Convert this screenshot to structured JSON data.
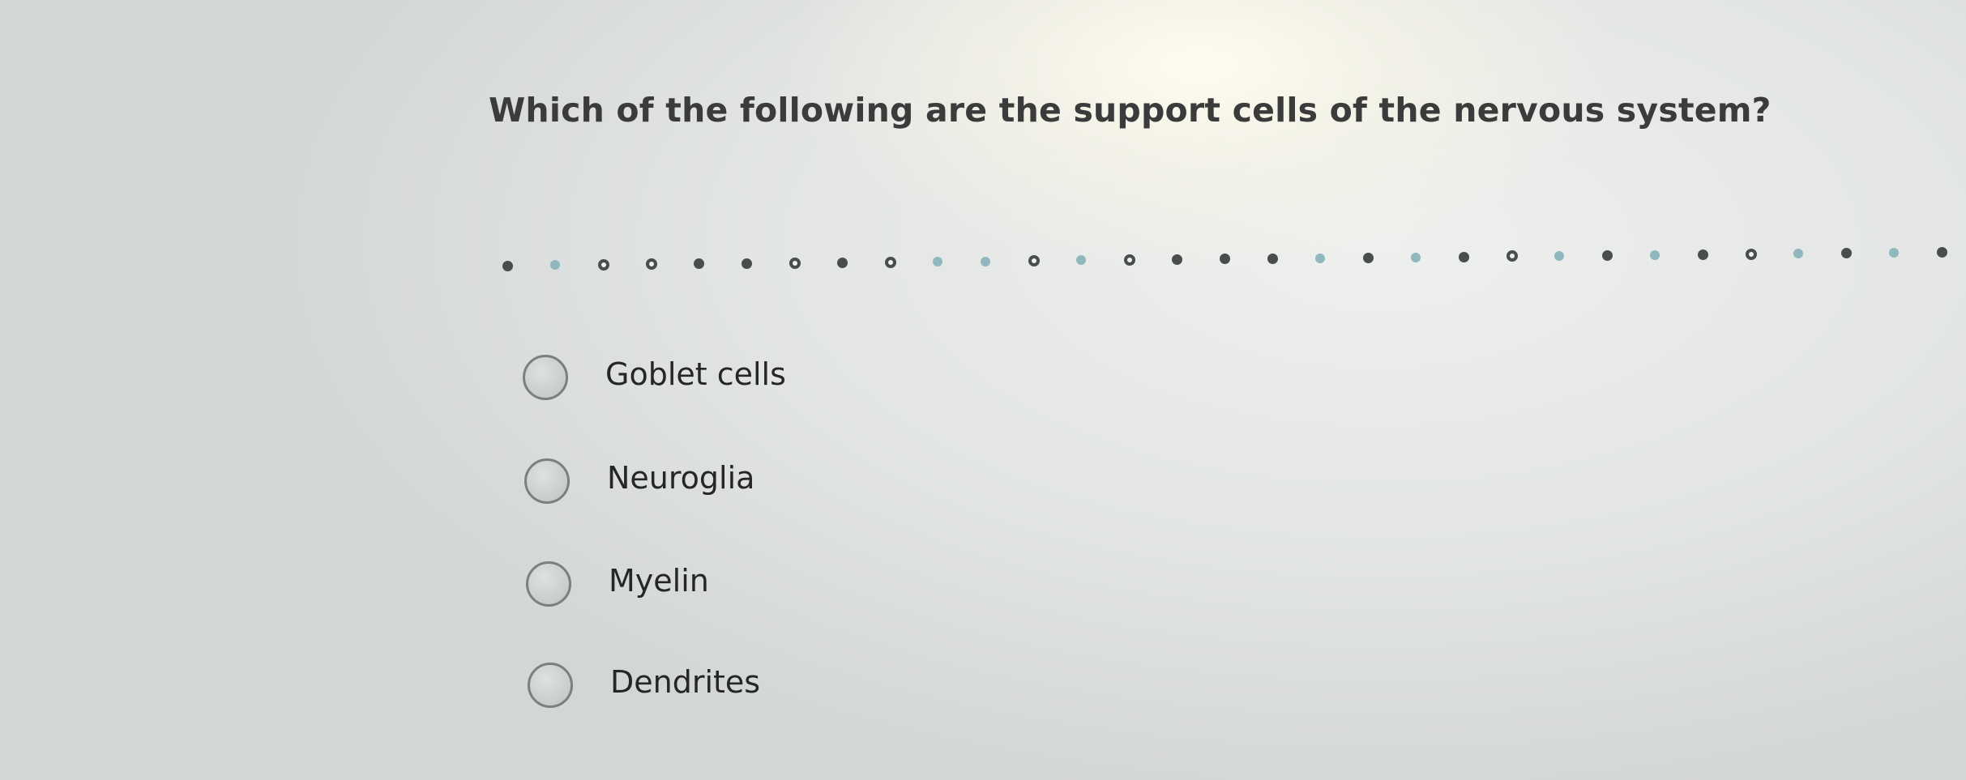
{
  "question": {
    "text": "Which of the following are the support cells of the nervous system?"
  },
  "options": [
    {
      "label": "Goblet cells"
    },
    {
      "label": "Neuroglia"
    },
    {
      "label": "Myelin"
    },
    {
      "label": "Dendrites"
    }
  ],
  "colors": {
    "question_text": "#3b3b3b",
    "option_text": "#262626",
    "radio_border": "#7c7f7f",
    "dot_dark": "#4a4d4d",
    "dot_teal": "#8fb7bd"
  }
}
